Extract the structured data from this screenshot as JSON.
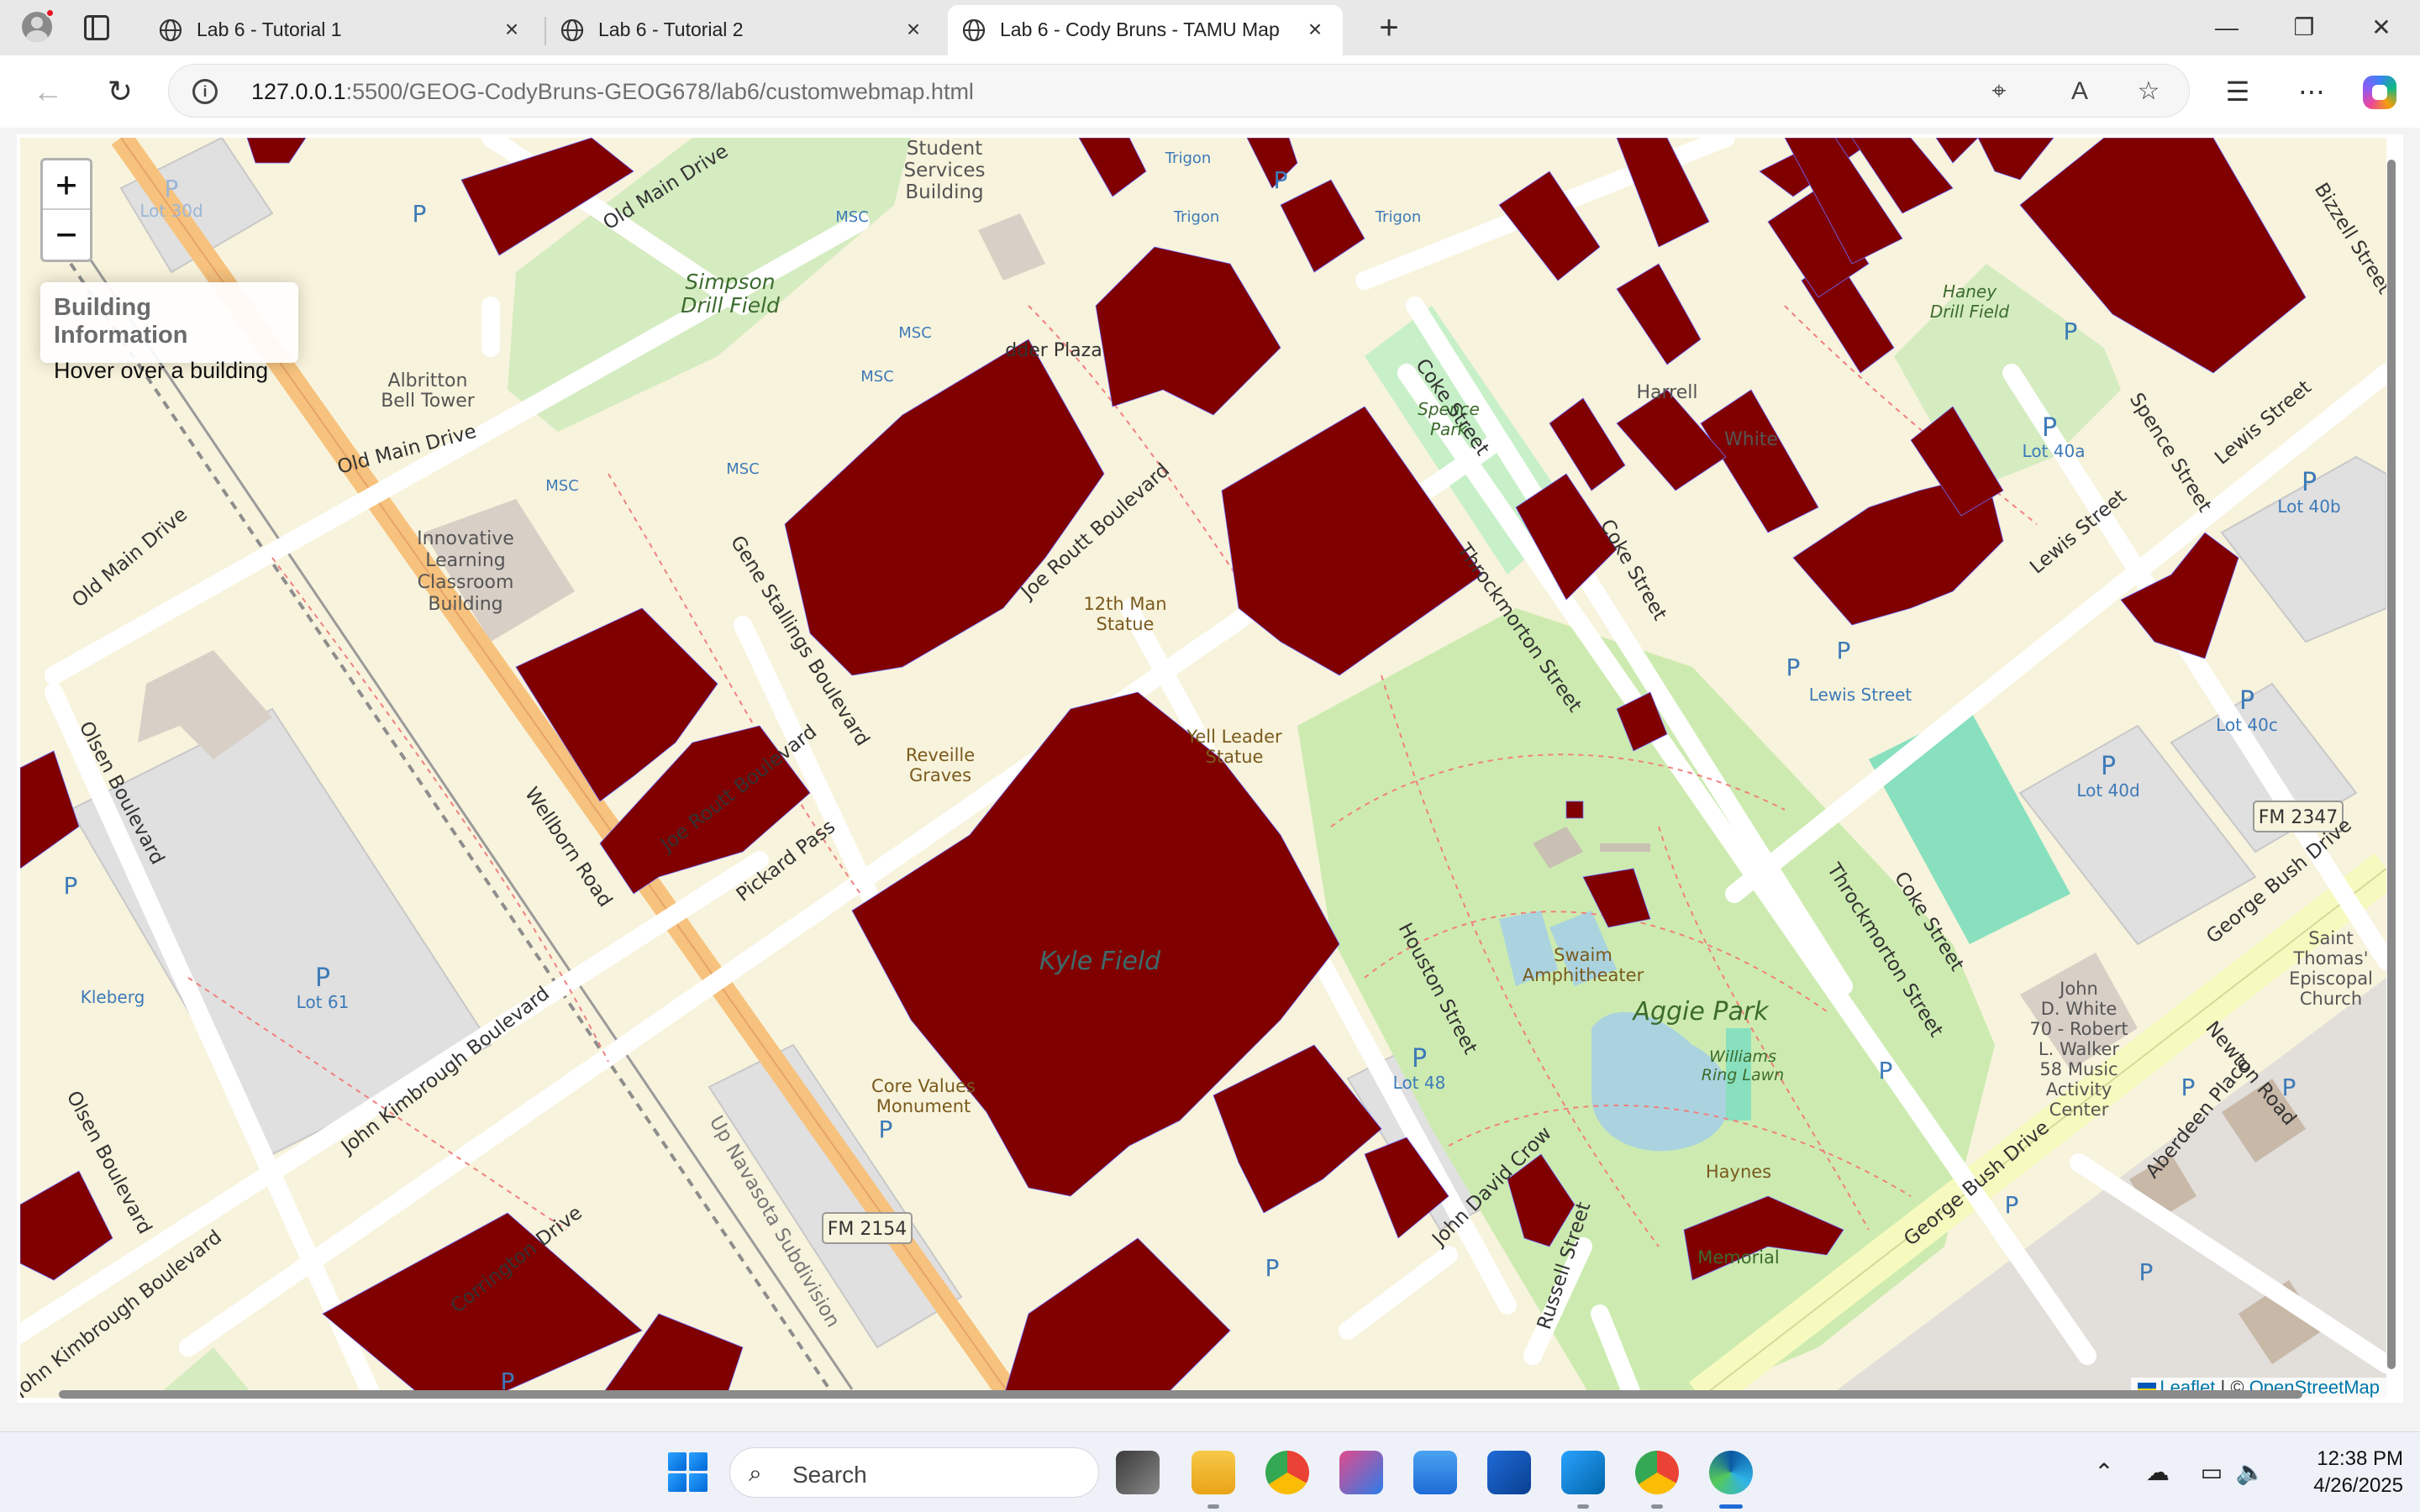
{
  "browser": {
    "tabs": [
      {
        "title": "Lab 6 - Tutorial 1",
        "active": false
      },
      {
        "title": "Lab 6 - Tutorial 2",
        "active": false
      },
      {
        "title": "Lab 6 - Cody Bruns - TAMU Map",
        "active": true
      }
    ],
    "address": {
      "host": "127.0.0.1",
      "path": ":5500/GEOG-CodyBruns-GEOG678/lab6/customwebmap.html"
    }
  },
  "map": {
    "zoom_in": "+",
    "zoom_out": "−",
    "info_panel": {
      "heading": "Building Information",
      "hint": "Hover over a building"
    },
    "attribution": {
      "leaflet": "Leaflet",
      "separator": " | © ",
      "osm": "OpenStreetMap"
    },
    "building_color": "#800000",
    "park_color": "#cdebb0",
    "labels": {
      "simpson": "Simpson",
      "simpson2": "Drill Field",
      "student_services": "Student",
      "student_services2": "Services",
      "student_services3": "Building",
      "albritton": "Albritton",
      "albritton2": "Bell Tower",
      "innovative": "Innovative",
      "innovative2": "Learning",
      "innovative3": "Classroom",
      "innovative4": "Building",
      "kyle_field": "Kyle Field",
      "aggie_park": "Aggie Park",
      "spence_park": "Spence",
      "spence_park2": "Park",
      "haney": "Haney",
      "haney2": "Drill Field",
      "twelfth_man": "12th Man",
      "twelfth_man2": "Statue",
      "yell_leader": "Yell Leader",
      "yell_leader2": "Statue",
      "reveille": "Reveille",
      "reveille2": "Graves",
      "core_values": "Core Values",
      "core_values2": "Monument",
      "swaim": "Swaim",
      "swaim2": "Amphitheater",
      "williams": "Williams",
      "williams2": "Ring Lawn",
      "haynes": "Haynes",
      "kleberg": "Kleberg",
      "lot61": "Lot 61",
      "lot48": "Lot 48",
      "lot30d": "Lot 30d",
      "lot40a": "Lot 40a",
      "lot40b": "Lot 40b",
      "lot40c": "Lot 40c",
      "lot40d": "Lot 40d",
      "lewis_street_stop": "Lewis Street",
      "msc": "MSC",
      "trigon": "Trigon",
      "fm2154": "FM 2154",
      "fm2347": "FM 2347",
      "john_white": "John",
      "john_white2": "D. White",
      "john_white3": "70 - Robert",
      "john_white4": "L. Walker",
      "john_white5": "58 Music",
      "john_white6": "Activity",
      "john_white7": "Center",
      "st_thomas": "Saint",
      "st_thomas2": "Thomas'",
      "st_thomas3": "Episcopal",
      "st_thomas4": "Church",
      "memorial": "Memorial",
      "ledder_plaza": "dder Plaza",
      "harrell": "Harrell",
      "white": "White",
      "up_navasota": "Up Navasota Subdivision"
    },
    "roads": {
      "old_main_drive": "Old Main Drive",
      "wellborn_road": "Wellborn Road",
      "joe_routt": "Joe Routt Boulevard",
      "gene_stallings": "Gene Stallings Boulevard",
      "olsen": "Olsen Boulevard",
      "john_kimbrough": "John Kimbrough Boulevard",
      "pickard_pass": "Pickard Pass",
      "corrington": "Corrington Drive",
      "houston": "Houston Street",
      "throckmorton": "Throckmorton Street",
      "coke": "Coke Street",
      "spence": "Spence Street",
      "lewis": "Lewis Street",
      "bizzell": "Bizzell Street",
      "george_bush": "George Bush Drive",
      "newton": "Newton Road",
      "aberdeen": "Aberdeen Place",
      "john_david_crow": "John David Crow",
      "russell": "Russell Street"
    }
  },
  "taskbar": {
    "search_placeholder": "Search",
    "time": "12:38 PM",
    "date": "4/26/2025"
  }
}
